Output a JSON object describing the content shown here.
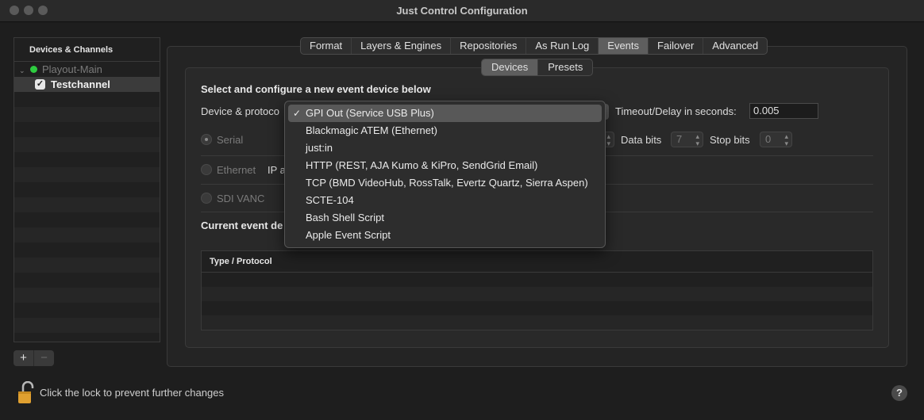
{
  "window": {
    "title": "Just Control Configuration"
  },
  "sidebar": {
    "header": "Devices & Channels",
    "group": {
      "label": "Playout-Main",
      "status_color": "#2ecc40"
    },
    "channel": {
      "label": "Testchannel",
      "checked": true
    }
  },
  "tabs": [
    "Format",
    "Layers & Engines",
    "Repositories",
    "As Run Log",
    "Events",
    "Failover",
    "Advanced"
  ],
  "active_tab": "Events",
  "subtabs": [
    "Devices",
    "Presets"
  ],
  "active_subtab": "Devices",
  "form": {
    "section_title": "Select and configure a new event device below",
    "device_protocol_label": "Device & protoco",
    "timeout_label": "Timeout/Delay in seconds:",
    "timeout_value": "0.005",
    "serial_label": "Serial",
    "data_bits_label": "Data bits",
    "data_bits_value": "7",
    "stop_bits_label": "Stop bits",
    "stop_bits_value": "0",
    "ethernet_label": "Ethernet",
    "ip_label": "IP a",
    "sdi_label": "SDI VANC",
    "current_label": "Current event de"
  },
  "table": {
    "header": "Type / Protocol"
  },
  "dropdown": {
    "options": [
      "GPI Out (Service USB Plus)",
      "Blackmagic ATEM (Ethernet)",
      "just:in",
      "HTTP (REST, AJA Kumo & KiPro, SendGrid Email)",
      "TCP (BMD VideoHub, RossTalk, Evertz Quartz, Sierra Aspen)",
      "SCTE-104",
      "Bash Shell Script",
      "Apple Event Script"
    ],
    "selected": "GPI Out (Service USB Plus)",
    "checkmark": "✓"
  },
  "footer": {
    "lock_text": "Click the lock to prevent further changes",
    "help_label": "?",
    "add_label": "+",
    "remove_label": "−"
  }
}
